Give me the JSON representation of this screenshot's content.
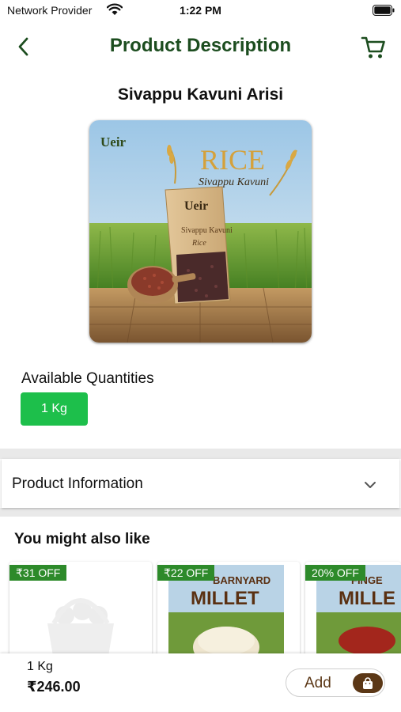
{
  "status_bar": {
    "carrier": "Network Provider",
    "time": "1:22 PM"
  },
  "header": {
    "title": "Product Description",
    "back_icon": "chevron-left-icon",
    "cart_icon": "shopping-cart-icon"
  },
  "product": {
    "name": "Sivappu Kavuni Arisi",
    "image": {
      "brand": "Ueir",
      "banner_title": "RICE",
      "banner_subtitle": "Sivappu Kavuni",
      "pack_label": "Sivappu Kavuni",
      "pack_sub": "Rice"
    }
  },
  "quantities": {
    "heading": "Available Quantities",
    "options": [
      "1 Kg"
    ],
    "selected": "1 Kg"
  },
  "product_information": {
    "label": "Product Information",
    "icon": "chevron-down-icon"
  },
  "suggestions": {
    "heading": "You might also like",
    "items": [
      {
        "badge": "₹31 OFF",
        "image_text": ""
      },
      {
        "badge": "₹22 OFF",
        "image_text": "BARNYARD\nMILLET"
      },
      {
        "badge": "20% OFF",
        "image_text": "FINGE\nMILLET"
      }
    ]
  },
  "bottom_bar": {
    "quantity": "1 Kg",
    "price": "₹246.00",
    "add_label": "Add",
    "add_icon": "shopping-bag-icon"
  },
  "colors": {
    "header_title": "#1c4d1f",
    "accent_green": "#1dbf4b",
    "badge_green": "#2d8a2a",
    "brown": "#5b3716"
  }
}
